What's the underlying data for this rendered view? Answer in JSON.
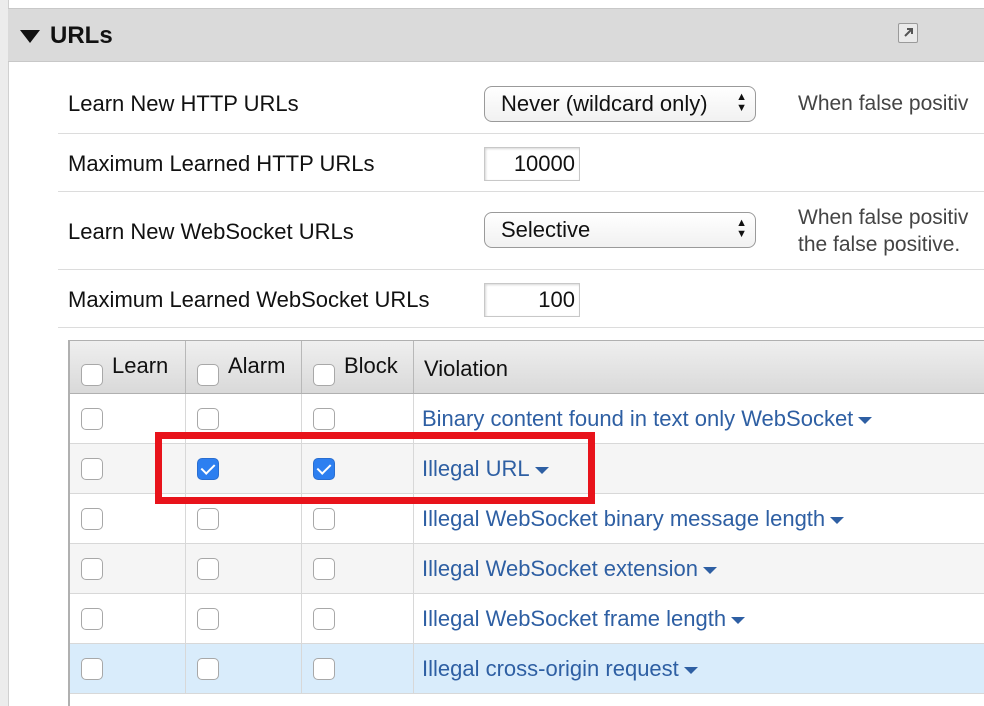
{
  "panel": {
    "title": "URLs",
    "popout_icon": "popout-icon"
  },
  "settings": [
    {
      "label": "Learn New HTTP URLs",
      "control": "select",
      "value": "Never (wildcard only)",
      "help": [
        "When false positiv"
      ]
    },
    {
      "label": "Maximum Learned HTTP URLs",
      "control": "input",
      "value": "10000",
      "help": []
    },
    {
      "label": "Learn New WebSocket URLs",
      "control": "select",
      "value": "Selective",
      "help": [
        "When false positiv",
        "the false positive."
      ]
    },
    {
      "label": "Maximum Learned WebSocket URLs",
      "control": "input",
      "value": "100",
      "help": []
    }
  ],
  "grid": {
    "headers": {
      "learn": "Learn",
      "alarm": "Alarm",
      "block": "Block",
      "violation": "Violation"
    },
    "rows": [
      {
        "violation": "Binary content found in text only WebSocket",
        "learn": false,
        "alarm": false,
        "block": false
      },
      {
        "violation": "Illegal URL",
        "learn": false,
        "alarm": true,
        "block": true
      },
      {
        "violation": "Illegal WebSocket binary message length",
        "learn": false,
        "alarm": false,
        "block": false
      },
      {
        "violation": "Illegal WebSocket extension",
        "learn": false,
        "alarm": false,
        "block": false
      },
      {
        "violation": "Illegal WebSocket frame length",
        "learn": false,
        "alarm": false,
        "block": false
      },
      {
        "violation": "Illegal cross-origin request",
        "learn": false,
        "alarm": false,
        "block": false
      }
    ]
  },
  "colors": {
    "link": "#2e5fa3",
    "checkbox_checked": "#2d7ff0",
    "annotation": "#e8131b",
    "selected_row": "#d9ecfb"
  }
}
